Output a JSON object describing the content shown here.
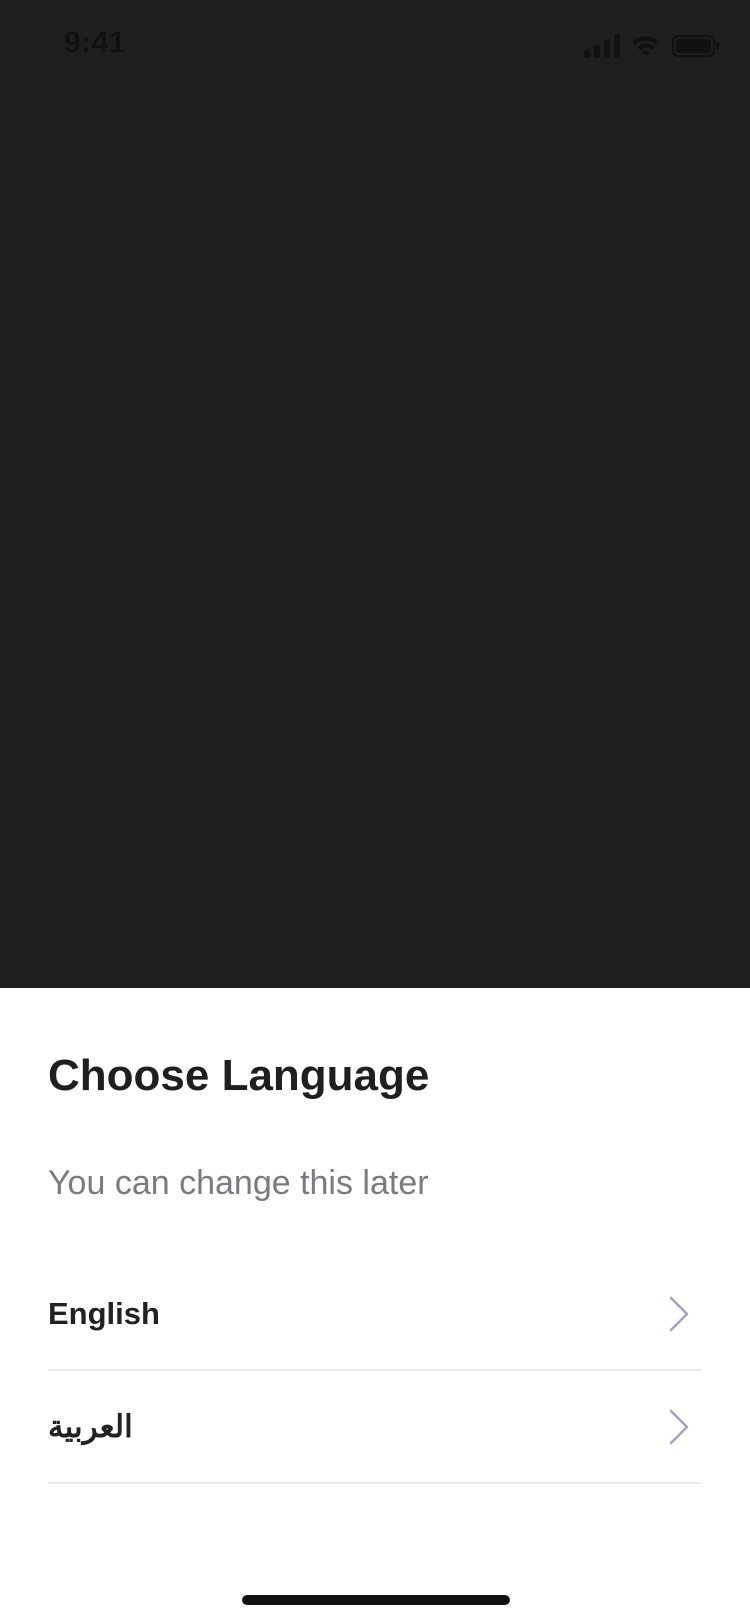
{
  "status_bar": {
    "time": "9:41",
    "icons": [
      "cellular-signal-icon",
      "wifi-icon",
      "battery-icon"
    ]
  },
  "sheet": {
    "title": "Choose Language",
    "subtitle": "You can change this later",
    "languages": [
      {
        "label": "English",
        "icon": "chevron-right-icon"
      },
      {
        "label": "العربية",
        "icon": "chevron-right-icon"
      }
    ]
  },
  "colors": {
    "backdrop": "#1e1e1e",
    "sheet_background": "#ffffff",
    "title_text": "#1f1f1f",
    "subtitle_text": "#7a7a82",
    "divider": "#ececf0",
    "chevron": "#a7a2c4"
  }
}
